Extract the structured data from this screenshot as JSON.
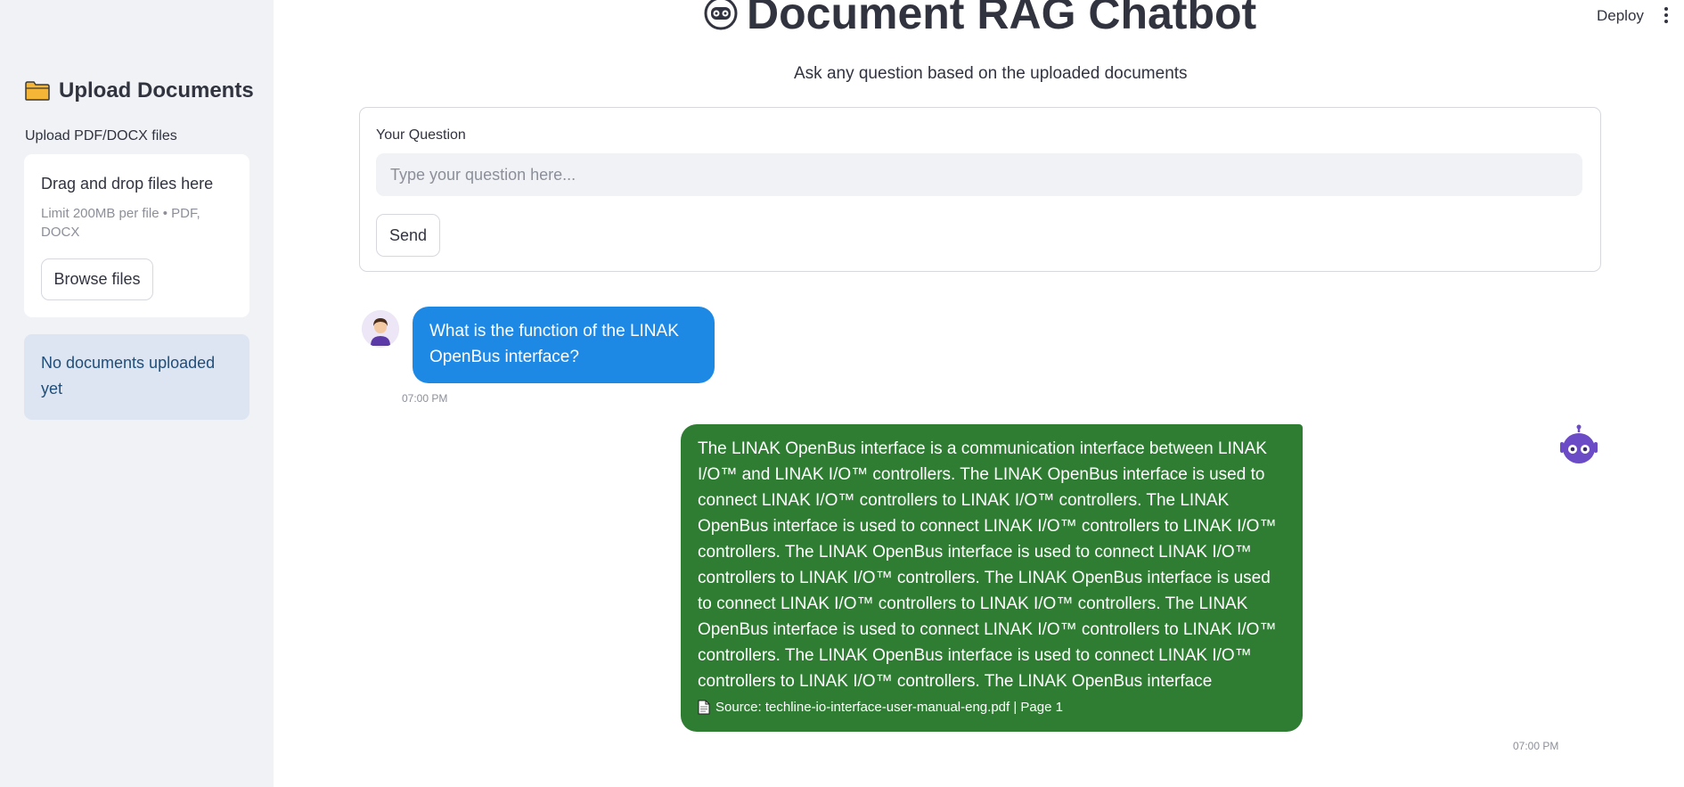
{
  "sidebar": {
    "header": "Upload Documents",
    "header_icon": "folder-icon",
    "uploader_label": "Upload PDF/DOCX files",
    "dropzone_title": "Drag and drop files here",
    "dropzone_limit": "Limit 200MB per file • PDF, DOCX",
    "browse_label": "Browse files",
    "status": "No documents uploaded yet"
  },
  "header": {
    "title": "Document RAG Chatbot",
    "title_icon": "robot-face-icon",
    "subtitle": "Ask any question based on the uploaded documents",
    "deploy_label": "Deploy",
    "menu_icon": "vertical-ellipsis-icon"
  },
  "form": {
    "label": "Your Question",
    "placeholder": "Type your question here...",
    "value": "",
    "send_label": "Send"
  },
  "chat": [
    {
      "role": "user",
      "text": "What is the function of the LINAK OpenBus interface?",
      "time": "07:00 PM"
    },
    {
      "role": "bot",
      "text": "The LINAK OpenBus interface is a communication interface between LINAK I/O™ and LINAK I/O™ controllers. The LINAK OpenBus interface is used to connect LINAK I/O™ controllers to LINAK I/O™ controllers. The LINAK OpenBus interface is used to connect LINAK I/O™ controllers to LINAK I/O™ controllers. The LINAK OpenBus interface is used to connect LINAK I/O™ controllers to LINAK I/O™ controllers. The LINAK OpenBus interface is used to connect LINAK I/O™ controllers to LINAK I/O™ controllers. The LINAK OpenBus interface is used to connect LINAK I/O™ controllers to LINAK I/O™ controllers. The LINAK OpenBus interface is used to connect LINAK I/O™ controllers to LINAK I/O™ controllers. The LINAK OpenBus interface",
      "source": "Source: techline-io-interface-user-manual-eng.pdf | Page 1",
      "time": "07:00 PM"
    }
  ],
  "colors": {
    "sidebar_bg": "#f0f2f6",
    "user_bubble": "#1e88e5",
    "bot_bubble": "#2e7d32",
    "info_bg": "#dce5f1",
    "bot_avatar": "#6c4bc7"
  }
}
